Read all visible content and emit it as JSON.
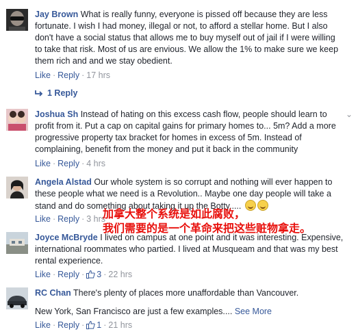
{
  "comments": [
    {
      "author": "Jay Brown",
      "text": "What is really funny, everyone is pissed off because they are less fortunate. I wish I had money, illegal or not, to afford a stellar home. But I also don't have a social status that allows me to buy myself out of jail if I were willing to take that risk. Most of us are envious. We allow the 1% to make sure we keep them rich and and we stay obedient.",
      "like": "Like",
      "reply": "Reply",
      "time": "17 hrs",
      "replies": "1 Reply"
    },
    {
      "author": "Joshua Sh",
      "text": "Instead of hating on this excess cash flow, people should learn to profit from it. Put a cap on capital gains for primary homes to... 5m? Add a more progressive property tax bracket for homes in excess of 5m. Instead of complaining, benefit from the money and put it back in the community",
      "like": "Like",
      "reply": "Reply",
      "time": "4 hrs"
    },
    {
      "author": "Angela Alstad",
      "text": "Our whole system is so corrupt and nothing will ever happen to these people what we need is a Revolution.. Maybe one day people will take a stand and do something about taking it up the Botty.....",
      "like": "Like",
      "reply": "Reply",
      "time": "3 hrs"
    },
    {
      "author": "Joyce McBryde",
      "text": "I lived on campus at one point and it was interesting. Expensive, international roommates who partied. I lived at Musqueam and that was my best rental experience.",
      "like": "Like",
      "reply": "Reply",
      "likes_count": "3",
      "time": "22 hrs"
    },
    {
      "author": "RC Chan",
      "text": "There's plenty of places more unaffordable than Vancouver.",
      "text2": "New York, San Francisco are just a few examples....",
      "see_more": "See More",
      "like": "Like",
      "reply": "Reply",
      "likes_count": "1",
      "time": "21 hrs"
    }
  ],
  "overlay": {
    "line1": "加拿大整个系统是如此腐败，",
    "line2": "我们需要的是一个革命来把这些赃物拿走。"
  },
  "colors": {
    "author": "#365899",
    "meta": "#90949c",
    "overlay": "#e8100c"
  }
}
